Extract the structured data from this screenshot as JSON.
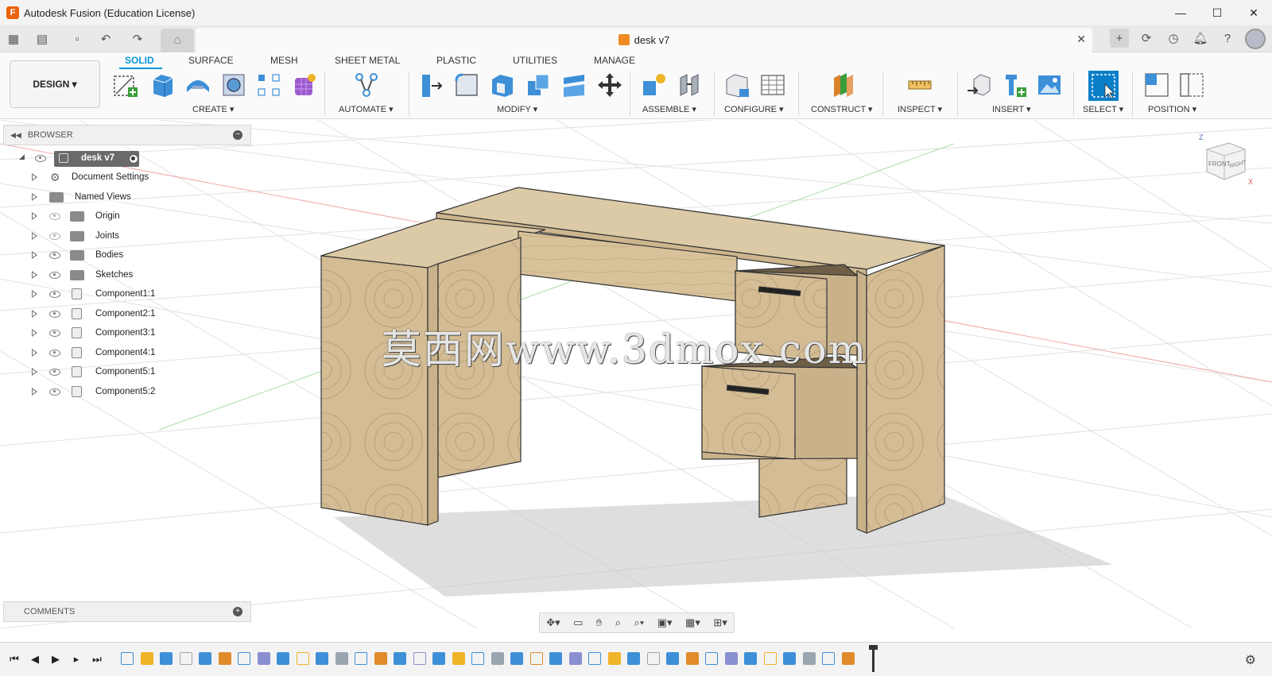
{
  "window": {
    "title": "Autodesk Fusion (Education License)",
    "controls": [
      "—",
      "☐",
      "✕"
    ]
  },
  "tabs": {
    "document": "desk v7"
  },
  "ribbon": {
    "workspace": "DESIGN ▾",
    "tabs": [
      "SOLID",
      "SURFACE",
      "MESH",
      "SHEET METAL",
      "PLASTIC",
      "UTILITIES",
      "MANAGE"
    ],
    "active_tab": "SOLID",
    "groups": [
      "CREATE ▾",
      "AUTOMATE ▾",
      "MODIFY ▾",
      "ASSEMBLE ▾",
      "CONFIGURE ▾",
      "CONSTRUCT ▾",
      "INSPECT ▾",
      "INSERT ▾",
      "SELECT ▾",
      "POSITION ▾"
    ]
  },
  "browser": {
    "title": "BROWSER",
    "root": "desk v7",
    "items": [
      {
        "label": "Document Settings",
        "icon": "gear-icon"
      },
      {
        "label": "Named Views",
        "icon": "folder-icon"
      },
      {
        "label": "Origin",
        "icon": "folder-icon"
      },
      {
        "label": "Joints",
        "icon": "folder-icon"
      },
      {
        "label": "Bodies",
        "icon": "folder-icon"
      },
      {
        "label": "Sketches",
        "icon": "folder-icon"
      },
      {
        "label": "Component1:1",
        "icon": "component-icon"
      },
      {
        "label": "Component2:1",
        "icon": "component-icon"
      },
      {
        "label": "Component3:1",
        "icon": "component-icon"
      },
      {
        "label": "Component4:1",
        "icon": "component-icon"
      },
      {
        "label": "Component5:1",
        "icon": "component-icon"
      },
      {
        "label": "Component5:2",
        "icon": "component-icon"
      }
    ]
  },
  "comments": {
    "title": "COMMENTS"
  },
  "viewcube": {
    "front": "FRONT",
    "right": "RIGHT",
    "axis_z": "Z",
    "axis_x": "X"
  },
  "watermark": "莫西网www.3dmox.com",
  "colors": {
    "accent": "#0696d7",
    "wood": "#d8c29c"
  }
}
